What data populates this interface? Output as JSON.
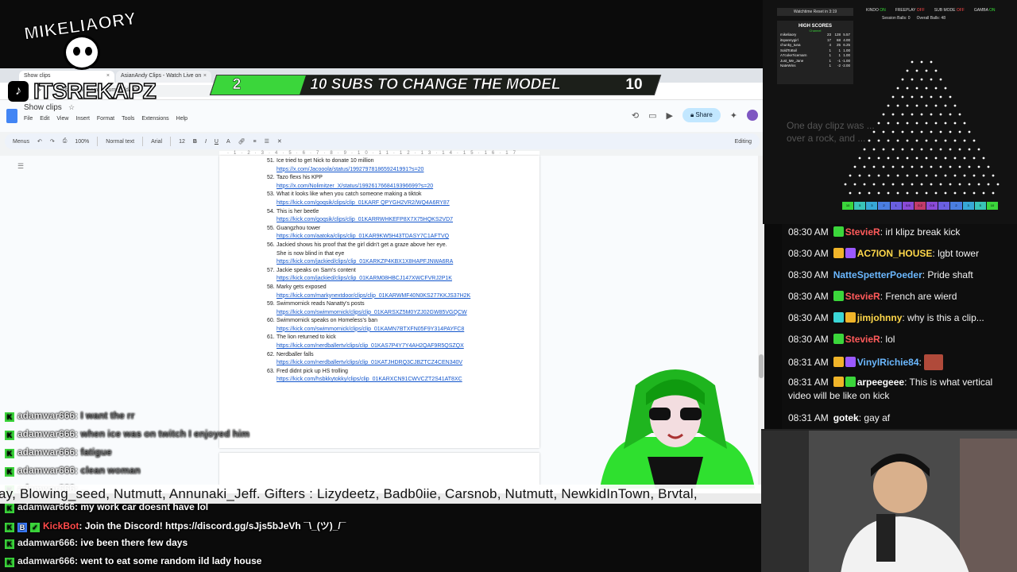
{
  "browser": {
    "tabs": [
      {
        "label": "Show clips",
        "close": "×"
      },
      {
        "label": "AsianAndy Clips - Watch Live on",
        "close": "×"
      }
    ],
    "url": "docs.google.com/document/d/1Ov..."
  },
  "docs": {
    "title": "Show clips",
    "star": "☆",
    "menus": [
      "File",
      "Edit",
      "View",
      "Insert",
      "Format",
      "Tools",
      "Extensions",
      "Help"
    ],
    "share_label": "Share",
    "toolbar": {
      "menus_label": "Menus",
      "zoom": "100%",
      "style": "Normal text",
      "font": "Arial",
      "size": "12",
      "mode": "Editing"
    },
    "items": [
      {
        "num": "51.",
        "text": "Ice tried to get Nick to donate 10 million",
        "link": "https://x.com/Jacooola/status/1992797818659241991?s=20"
      },
      {
        "num": "52.",
        "text": "Tazo flexs his KPP",
        "link": "https://x.com/Nolimitzer_X/status/1992617668419396699?s=20"
      },
      {
        "num": "53.",
        "text": "What it looks like when you catch someone making a tiktok",
        "link": "https://kick.com/goqsik/clips/clip_01KARF QPYGH2VR2/WQ4A6RY87"
      },
      {
        "num": "54.",
        "text": "This is her beetle",
        "link": "https://kick.com/goqsik/clips/clip_01KARRWHKEFP8X7X75HQKS2VD7"
      },
      {
        "num": "55.",
        "text": "Guangzhou tower",
        "link": "https://kick.com/aatoka/clips/clip_01KAR9KW5H43TDASY7C1AFTVQ"
      },
      {
        "num": "56.",
        "text": "Jackied shows his proof that the girl didn't get a graze above her eye.",
        "cont": "She is now blind in that eye",
        "link": "https://kick.com/jackied/clips/clip_01KARKZP4KBX1X8HAPFJNWA6RA"
      },
      {
        "num": "57.",
        "text": "Jackie speaks on Sam's content",
        "link": "https://kick.com/jackied/clips/clip_01KARM08HBCJ147XWCFVRJ2P1K"
      },
      {
        "num": "58.",
        "text": "Marky gets exposed",
        "link": "https://kick.com/markynextdoor/clips/clip_01KARWMF40N0KS277KKJS37H2K"
      },
      {
        "num": "59.",
        "text": "Swimmornick reads Nanatty's posts",
        "link": "https://kick.com/swimmornick/clips/clip_01KARSXZ5M0YZJ02GW85VGQCW"
      },
      {
        "num": "60.",
        "text": "Swimmornick speaks on Homeless's ban",
        "link": "https://kick.com/swimmornick/clips/clip_01KAMN7BTXFN05F9Y314PAYFC8"
      },
      {
        "num": "61.",
        "text": "The lion returned to kick",
        "link": "https://kick.com/nerdballertv/clips/clip_01KAS7P4Y7Y4AH2QAF9R5QSZQX"
      },
      {
        "num": "62.",
        "text": "Nerdballer falls",
        "link": "https://kick.com/nerdballertv/clips/clip_01KATJHDRQ3CJBZTCZ4CEN340V"
      },
      {
        "num": "63.",
        "text": "Fred didnt pick up HS trolling",
        "link": "https://kick.com/hsbkkytokky/clips/clip_01KARXCN91CWVCZT2S41AT8XC"
      }
    ]
  },
  "overlay": {
    "logo_text": "MIKELIAORY",
    "tiktok_handle": "ITSREKAPZ",
    "goal": {
      "current": "2",
      "label": "10 SUBS TO CHANGE THE MODEL",
      "target": "10",
      "progress": 0.2
    }
  },
  "scoreboard": {
    "watchtime": "Watchtime Reset in 3:19",
    "flags": [
      {
        "label": "KINDO",
        "state": "ON",
        "on": true
      },
      {
        "label": "FREEPLAY",
        "state": "OFF",
        "on": false
      },
      {
        "label": "SUB MODE",
        "state": "OFF",
        "on": false
      },
      {
        "label": "GAMBA",
        "state": "ON",
        "on": true
      }
    ],
    "session_balls": "Session Balls: 0",
    "overall_balls": "Overall Balls: 48",
    "high_scores_title": "HIGH SCORES",
    "high_scores_sub": "Channel",
    "high_scores": [
      {
        "name": "mikeliaory",
        "a": "23",
        "b": "128",
        "c": "5.57"
      },
      {
        "name": "itspannygirl",
        "a": "17",
        "b": "68",
        "c": "4.00"
      },
      {
        "name": "chunky_tuna",
        "a": "4",
        "b": "25",
        "c": "6.25"
      },
      {
        "name": "SoldToBoil",
        "a": "1",
        "b": "1",
        "c": "1.00"
      },
      {
        "name": "A7coke7icemarn",
        "a": "1",
        "b": "1",
        "c": "1.00"
      },
      {
        "name": "Just_Me_Jane",
        "a": "1",
        "b": "-1",
        "c": "-1.00"
      },
      {
        "name": "NateWins",
        "a": "1",
        "b": "-2",
        "c": "-2.00"
      }
    ],
    "ghost_chat": [
      "One day clipz was ...",
      "over a rock, and ..."
    ],
    "bins": [
      "10",
      "5",
      "3",
      "2",
      "1",
      "0.5",
      "0.2",
      "0.5",
      "1",
      "2",
      "3",
      "5",
      "10"
    ]
  },
  "right_chat": [
    {
      "time": "08:30 AM",
      "user": "StevieR",
      "color": "#ff5a5a",
      "text": "irl klipz break kick",
      "badges": [
        "#3bd63b"
      ]
    },
    {
      "time": "08:30 AM",
      "user": "AC7ION_HOUSE",
      "color": "#ffd84a",
      "text": "lgbt tower",
      "badges": [
        "#f0b429",
        "#9b59ff"
      ]
    },
    {
      "time": "08:30 AM",
      "user": "NatteSpetterPoeder",
      "color": "#6bb8ff",
      "text": "Pride shaft",
      "badges": []
    },
    {
      "time": "08:30 AM",
      "user": "StevieR",
      "color": "#ff5a5a",
      "text": "French are wierd",
      "badges": [
        "#3bd63b"
      ]
    },
    {
      "time": "08:30 AM",
      "user": "jimjohnny",
      "color": "#ffd84a",
      "text": "why is this a clip...",
      "badges": [
        "#3bd6d6",
        "#f0b429"
      ]
    },
    {
      "time": "08:30 AM",
      "user": "StevieR",
      "color": "#ff5a5a",
      "text": "lol",
      "badges": [
        "#3bd63b"
      ]
    },
    {
      "time": "08:31 AM",
      "user": "VinylRichie84",
      "color": "#6bb8ff",
      "text": "",
      "badges": [
        "#f0b429",
        "#9b59ff"
      ]
    },
    {
      "time": "08:31 AM",
      "user": "arpeegeee",
      "color": "#ffffff",
      "text": "This is what vertical video will be like on kick",
      "badges": [
        "#f0b429",
        "#3bd63b"
      ]
    },
    {
      "time": "08:31 AM",
      "user": "gotek",
      "color": "#ffffff",
      "text": "gay af",
      "badges": []
    }
  ],
  "left_chat": [
    {
      "user": "adamwar666",
      "text": "I want the rr",
      "faded": true
    },
    {
      "user": "adamwar666",
      "text": "when ice was on twitch I enjoyed him",
      "faded": true
    },
    {
      "user": "adamwar666",
      "text": "fatigue",
      "faded": true
    },
    {
      "user": "adamwar666",
      "text": "clean woman",
      "faded": true
    },
    {
      "user": "adamwar666",
      "text": "...",
      "faded": true
    },
    {
      "user": "adamwar666",
      "text": "my work car doesnt have lol",
      "faded": false
    },
    {
      "user": "KickBot",
      "text": "Join the Discord! https://discord.gg/sJjs5bJeVh ¯\\_(ツ)_/¯",
      "faded": false,
      "bot": true
    },
    {
      "user": "adamwar666",
      "text": "ive been there few days",
      "faded": false
    },
    {
      "user": "adamwar666",
      "text": "went to eat some random ild lady house",
      "faded": false
    }
  ],
  "ticker": "ay, Blowing_seed, Nutmutt, Annunaki_Jeff. Gifters : Lizydeetz, Badb0iie, Carsnob, Nutmutt, NewkidInTown, Brvtal,"
}
